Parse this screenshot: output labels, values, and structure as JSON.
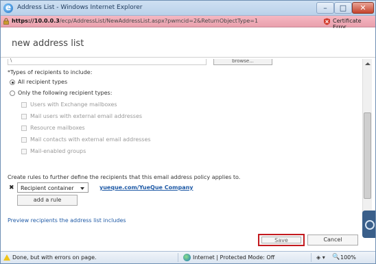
{
  "window": {
    "title": "Address List - Windows Internet Explorer",
    "url_host": "https://10.0.0.3",
    "url_path": "/ecp/AddressList/NewAddressList.aspx?pwmcid=2&ReturnObjectType=1",
    "cert_error": "Certificate Error"
  },
  "page": {
    "title": "new address list",
    "partial_field_value": "\\",
    "browse_label": "browse...",
    "recipients_heading": "*Types of recipients to include:",
    "radio_all": "All recipient types",
    "radio_only": "Only the following recipient types:",
    "checkboxes": [
      "Users with Exchange mailboxes",
      "Mail users with external email addresses",
      "Resource mailboxes",
      "Mail contacts with external email addresses",
      "Mail-enabled groups"
    ],
    "rules_text": "Create rules to further define the recipients that this email address policy applies to.",
    "remove_rule_glyph": "✖",
    "rule_select_value": "Recipient container",
    "rule_value_link": "yueque.com/YueQue Company",
    "add_rule_label": "add a rule",
    "preview_link": "Preview recipients the address list includes",
    "save_label": "Save",
    "cancel_label": "Cancel"
  },
  "status": {
    "text": "Done, but with errors on page.",
    "zone": "Internet | Protected Mode: Off",
    "zoom": "100%"
  },
  "colors": {
    "address_bar_error": "#f5b8c2",
    "save_highlight": "#c3191e",
    "link": "#1f5aa6"
  }
}
